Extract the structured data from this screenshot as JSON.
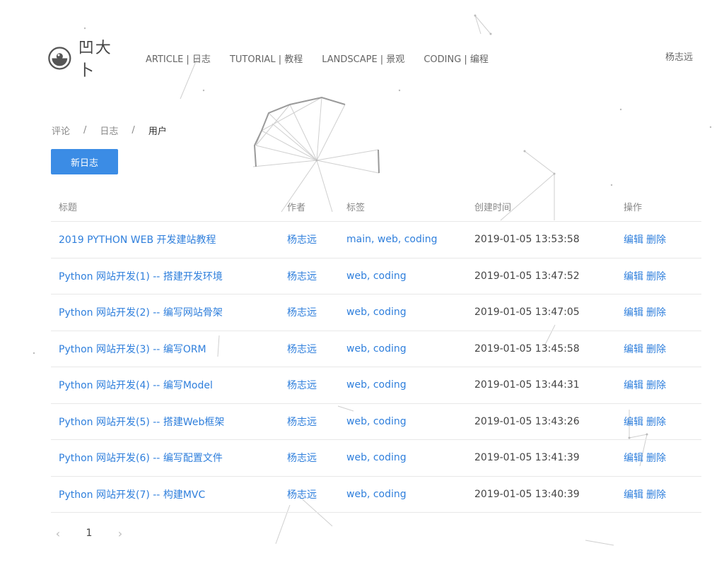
{
  "header": {
    "logo_text": "凹大卜",
    "nav": [
      {
        "label": "ARTICLE | 日志"
      },
      {
        "label": "TUTORIAL | 教程"
      },
      {
        "label": "LANDSCAPE | 景观"
      },
      {
        "label": "CODING | 编程"
      }
    ],
    "user_name": "杨志远"
  },
  "breadcrumb": {
    "items": [
      "评论",
      "日志",
      "用户"
    ],
    "separator": "/"
  },
  "new_button_label": "新日志",
  "table": {
    "headers": {
      "title": "标题",
      "author": "作者",
      "tags": "标签",
      "created": "创建时间",
      "actions": "操作"
    },
    "edit_label": "编辑",
    "delete_label": "删除",
    "rows": [
      {
        "title": "2019 PYTHON WEB 开发建站教程",
        "author": "杨志远",
        "tags": "main, web, coding",
        "created": "2019-01-05 13:53:58"
      },
      {
        "title": "Python 网站开发(1) -- 搭建开发环境",
        "author": "杨志远",
        "tags": "web, coding",
        "created": "2019-01-05 13:47:52"
      },
      {
        "title": "Python 网站开发(2) -- 编写网站骨架",
        "author": "杨志远",
        "tags": "web, coding",
        "created": "2019-01-05 13:47:05"
      },
      {
        "title": "Python 网站开发(3) -- 编写ORM",
        "author": "杨志远",
        "tags": "web, coding",
        "created": "2019-01-05 13:45:58"
      },
      {
        "title": "Python 网站开发(4) -- 编写Model",
        "author": "杨志远",
        "tags": "web, coding",
        "created": "2019-01-05 13:44:31"
      },
      {
        "title": "Python 网站开发(5) -- 搭建Web框架",
        "author": "杨志远",
        "tags": "web, coding",
        "created": "2019-01-05 13:43:26"
      },
      {
        "title": "Python 网站开发(6) -- 编写配置文件",
        "author": "杨志远",
        "tags": "web, coding",
        "created": "2019-01-05 13:41:39"
      },
      {
        "title": "Python 网站开发(7) -- 构建MVC",
        "author": "杨志远",
        "tags": "web, coding",
        "created": "2019-01-05 13:40:39"
      }
    ]
  },
  "pagination": {
    "current_page": "1",
    "prev_icon": "chevron-left-icon",
    "next_icon": "chevron-right-icon"
  },
  "colors": {
    "accent": "#3b8ce5",
    "link": "#2f7fdc"
  }
}
